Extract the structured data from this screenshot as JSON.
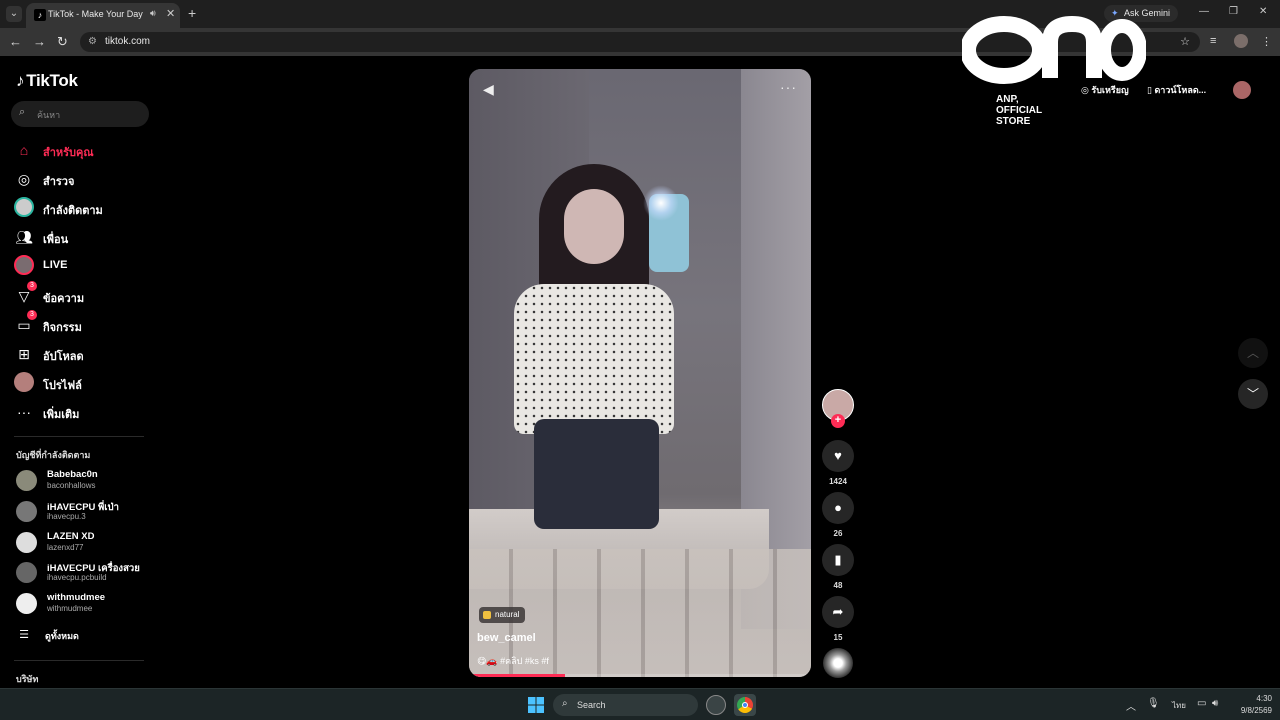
{
  "browser": {
    "tab_title": "TikTok - Make Your Day",
    "new_tab": "+",
    "ask_gemini": "Ask Gemini",
    "url": "tiktok.com"
  },
  "sidebar": {
    "logo": "TikTok",
    "search_placeholder": "ค้นหา",
    "menu": [
      {
        "label": "สำหรับคุณ",
        "icon": "home-icon"
      },
      {
        "label": "สำรวจ",
        "icon": "compass-icon"
      },
      {
        "label": "กำลังติดตาม",
        "icon": "following-icon"
      },
      {
        "label": "เพื่อน",
        "icon": "friends-icon"
      },
      {
        "label": "LIVE",
        "icon": "live-icon"
      },
      {
        "label": "ข้อความ",
        "icon": "messages-icon",
        "badge": "3"
      },
      {
        "label": "กิจกรรม",
        "icon": "activity-icon",
        "badge": "3"
      },
      {
        "label": "อัปโหลด",
        "icon": "upload-icon"
      },
      {
        "label": "โปรไฟล์",
        "icon": "profile-icon"
      },
      {
        "label": "เพิ่มเติม",
        "icon": "more-icon"
      }
    ],
    "following_title": "บัญชีที่กำลังติดตาม",
    "following": [
      {
        "name": "Babebac0n",
        "user": "baconhallows"
      },
      {
        "name": "iHAVECPU พี่เป่า",
        "user": "ihavecpu.3"
      },
      {
        "name": "LAZEN XD",
        "user": "lazenxd77"
      },
      {
        "name": "iHAVECPU เครื่องสวย",
        "user": "ihavecpu.pcbuild"
      },
      {
        "name": "withmudmee",
        "user": "withmudmee"
      }
    ],
    "see_all": "ดูทั้งหมด",
    "company": "บริษัท"
  },
  "header": {
    "coins": "รับเหรียญ",
    "download": "ดาวน์โหลด...",
    "watermark_store": "ANP, OFFICIAL STORE"
  },
  "video": {
    "effect_tag": "natural",
    "author": "bew_camel",
    "caption": "😋🚗 #คลิป #ks #f",
    "progress": 0.28
  },
  "actions": {
    "likes": "1424",
    "comments": "26",
    "saves": "48",
    "shares": "15"
  },
  "taskbar": {
    "search": "Search",
    "lang": "ไทย",
    "time": "4:30",
    "date": "9/8/2569"
  }
}
